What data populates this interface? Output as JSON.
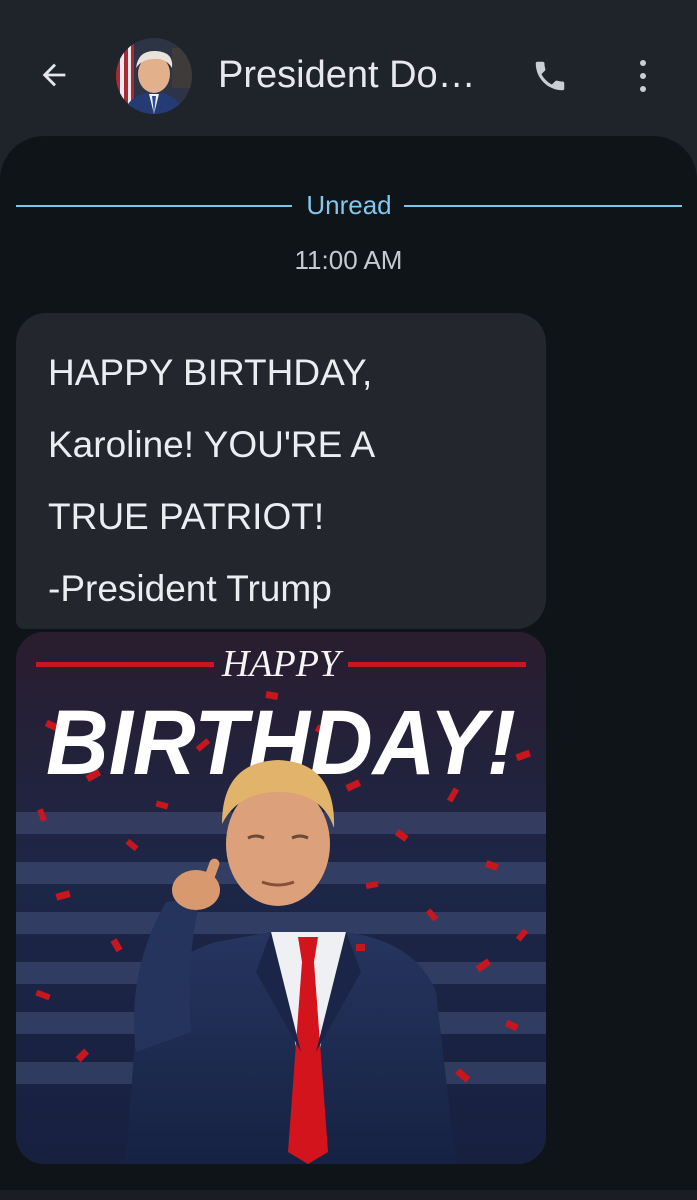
{
  "header": {
    "contact_name": "President Do…",
    "back_icon": "arrow-back-icon",
    "call_icon": "phone-icon",
    "more_icon": "more-vert-icon"
  },
  "conversation": {
    "unread_label": "Unread",
    "timestamp": "11:00 AM",
    "message_lines": [
      "HAPPY BIRTHDAY,",
      "Karoline! YOU'RE A",
      "TRUE PATRIOT!",
      "-President Trump"
    ],
    "image": {
      "happy_text": "HAPPY",
      "birthday_text": "BIRTHDAY!"
    }
  },
  "colors": {
    "app_background": "#1f232a",
    "conversation_background": "#0f1418",
    "bubble_background": "#23272d",
    "unread_accent": "#7ec5ea",
    "banner_red": "#c8161e"
  }
}
